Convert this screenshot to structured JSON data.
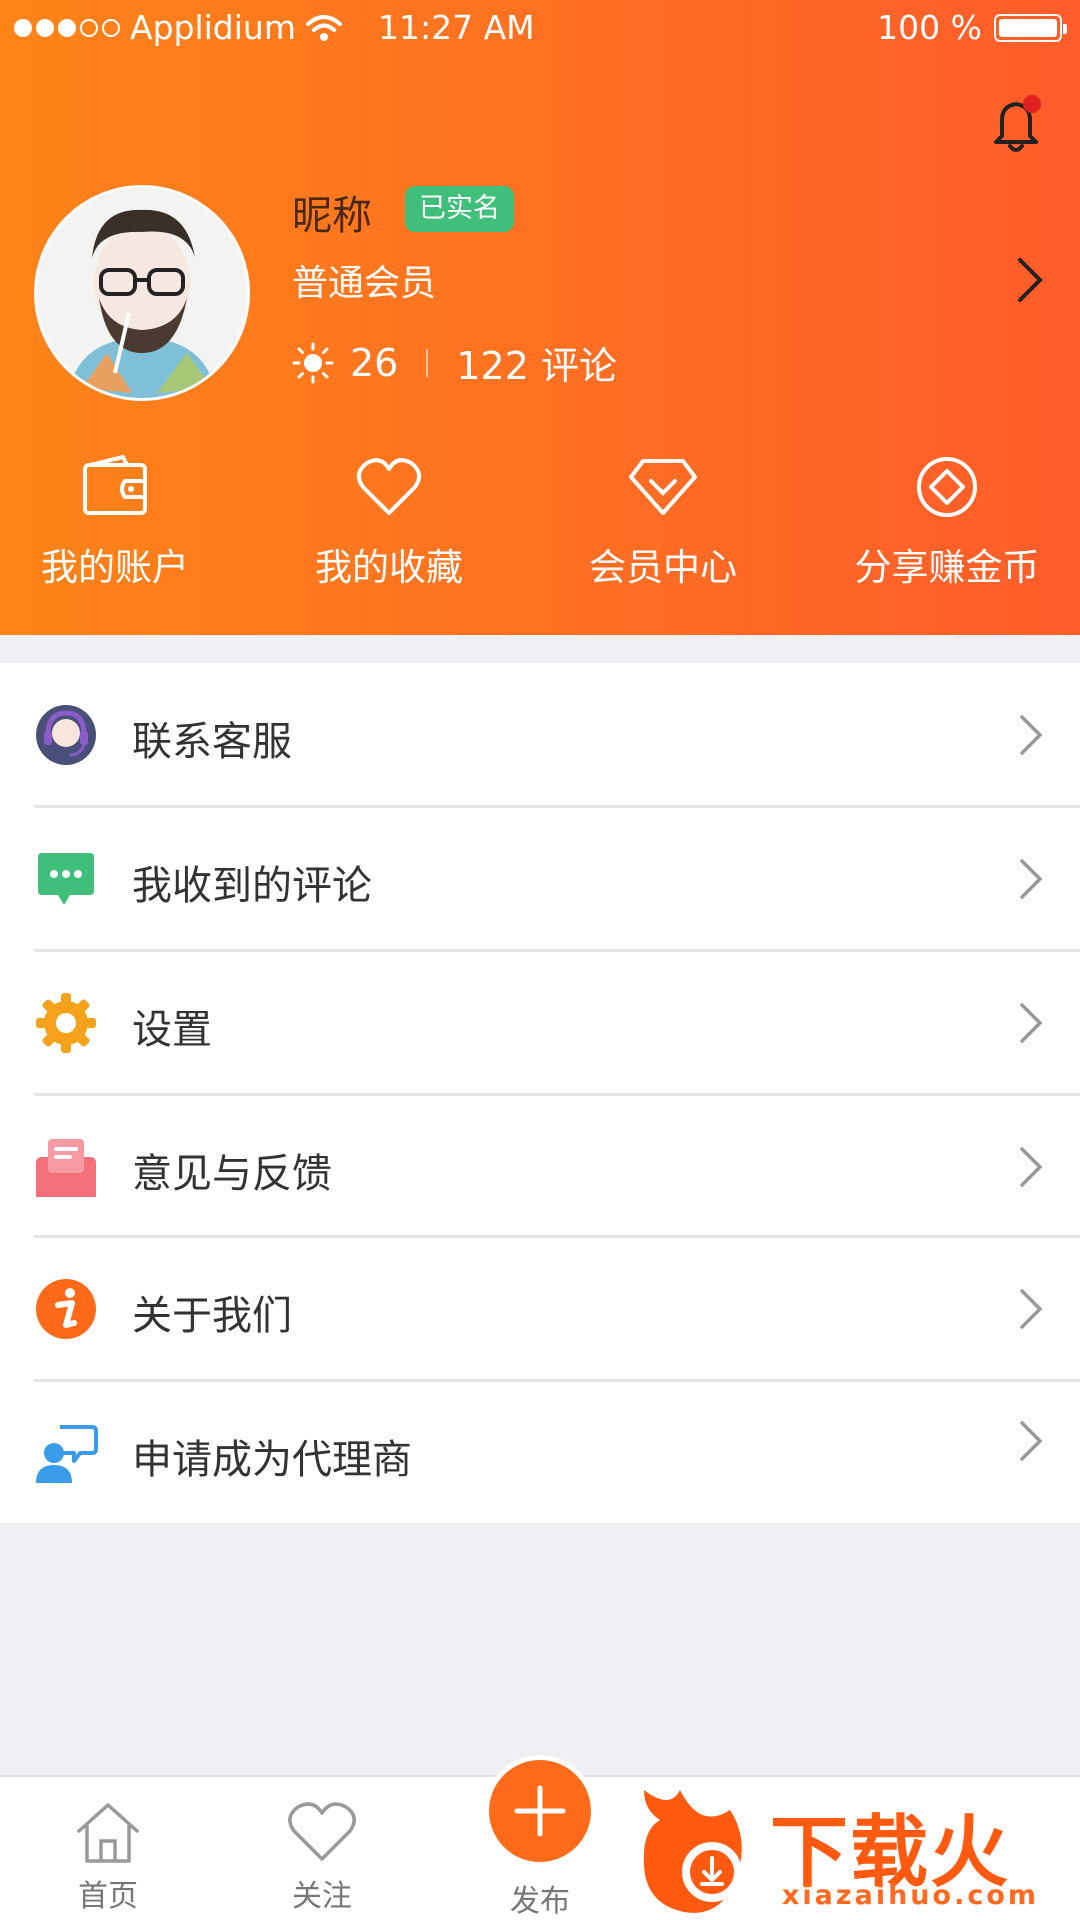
{
  "status_bar": {
    "carrier": "Applidium",
    "time": "11:27 AM",
    "battery": "100 %"
  },
  "profile": {
    "nickname": "昵称",
    "verified_badge": "已实名",
    "member_level": "普通会员",
    "sun_count": "26",
    "comments": "122 评论"
  },
  "quick_actions": [
    {
      "label": "我的账户",
      "icon": "wallet-icon"
    },
    {
      "label": "我的收藏",
      "icon": "heart-icon"
    },
    {
      "label": "会员中心",
      "icon": "diamond-icon"
    },
    {
      "label": "分享赚金币",
      "icon": "coin-icon"
    }
  ],
  "menu": [
    {
      "label": "联系客服",
      "icon": "customer-service-icon"
    },
    {
      "label": "我收到的评论",
      "icon": "comment-bubble-icon"
    },
    {
      "label": "设置",
      "icon": "gear-icon"
    },
    {
      "label": "意见与反馈",
      "icon": "feedback-mail-icon"
    },
    {
      "label": "关于我们",
      "icon": "info-icon"
    },
    {
      "label": "申请成为代理商",
      "icon": "agent-chat-icon"
    }
  ],
  "tab_bar": {
    "home": "首页",
    "follow": "关注",
    "publish": "发布"
  },
  "watermark": {
    "brand": "下载火",
    "url": "xiazaihuo.com"
  },
  "colors": {
    "header_start": "#ff8418",
    "header_end": "#ff5c2a",
    "accent": "#ff6b1a",
    "verified": "#3fbf7a"
  }
}
